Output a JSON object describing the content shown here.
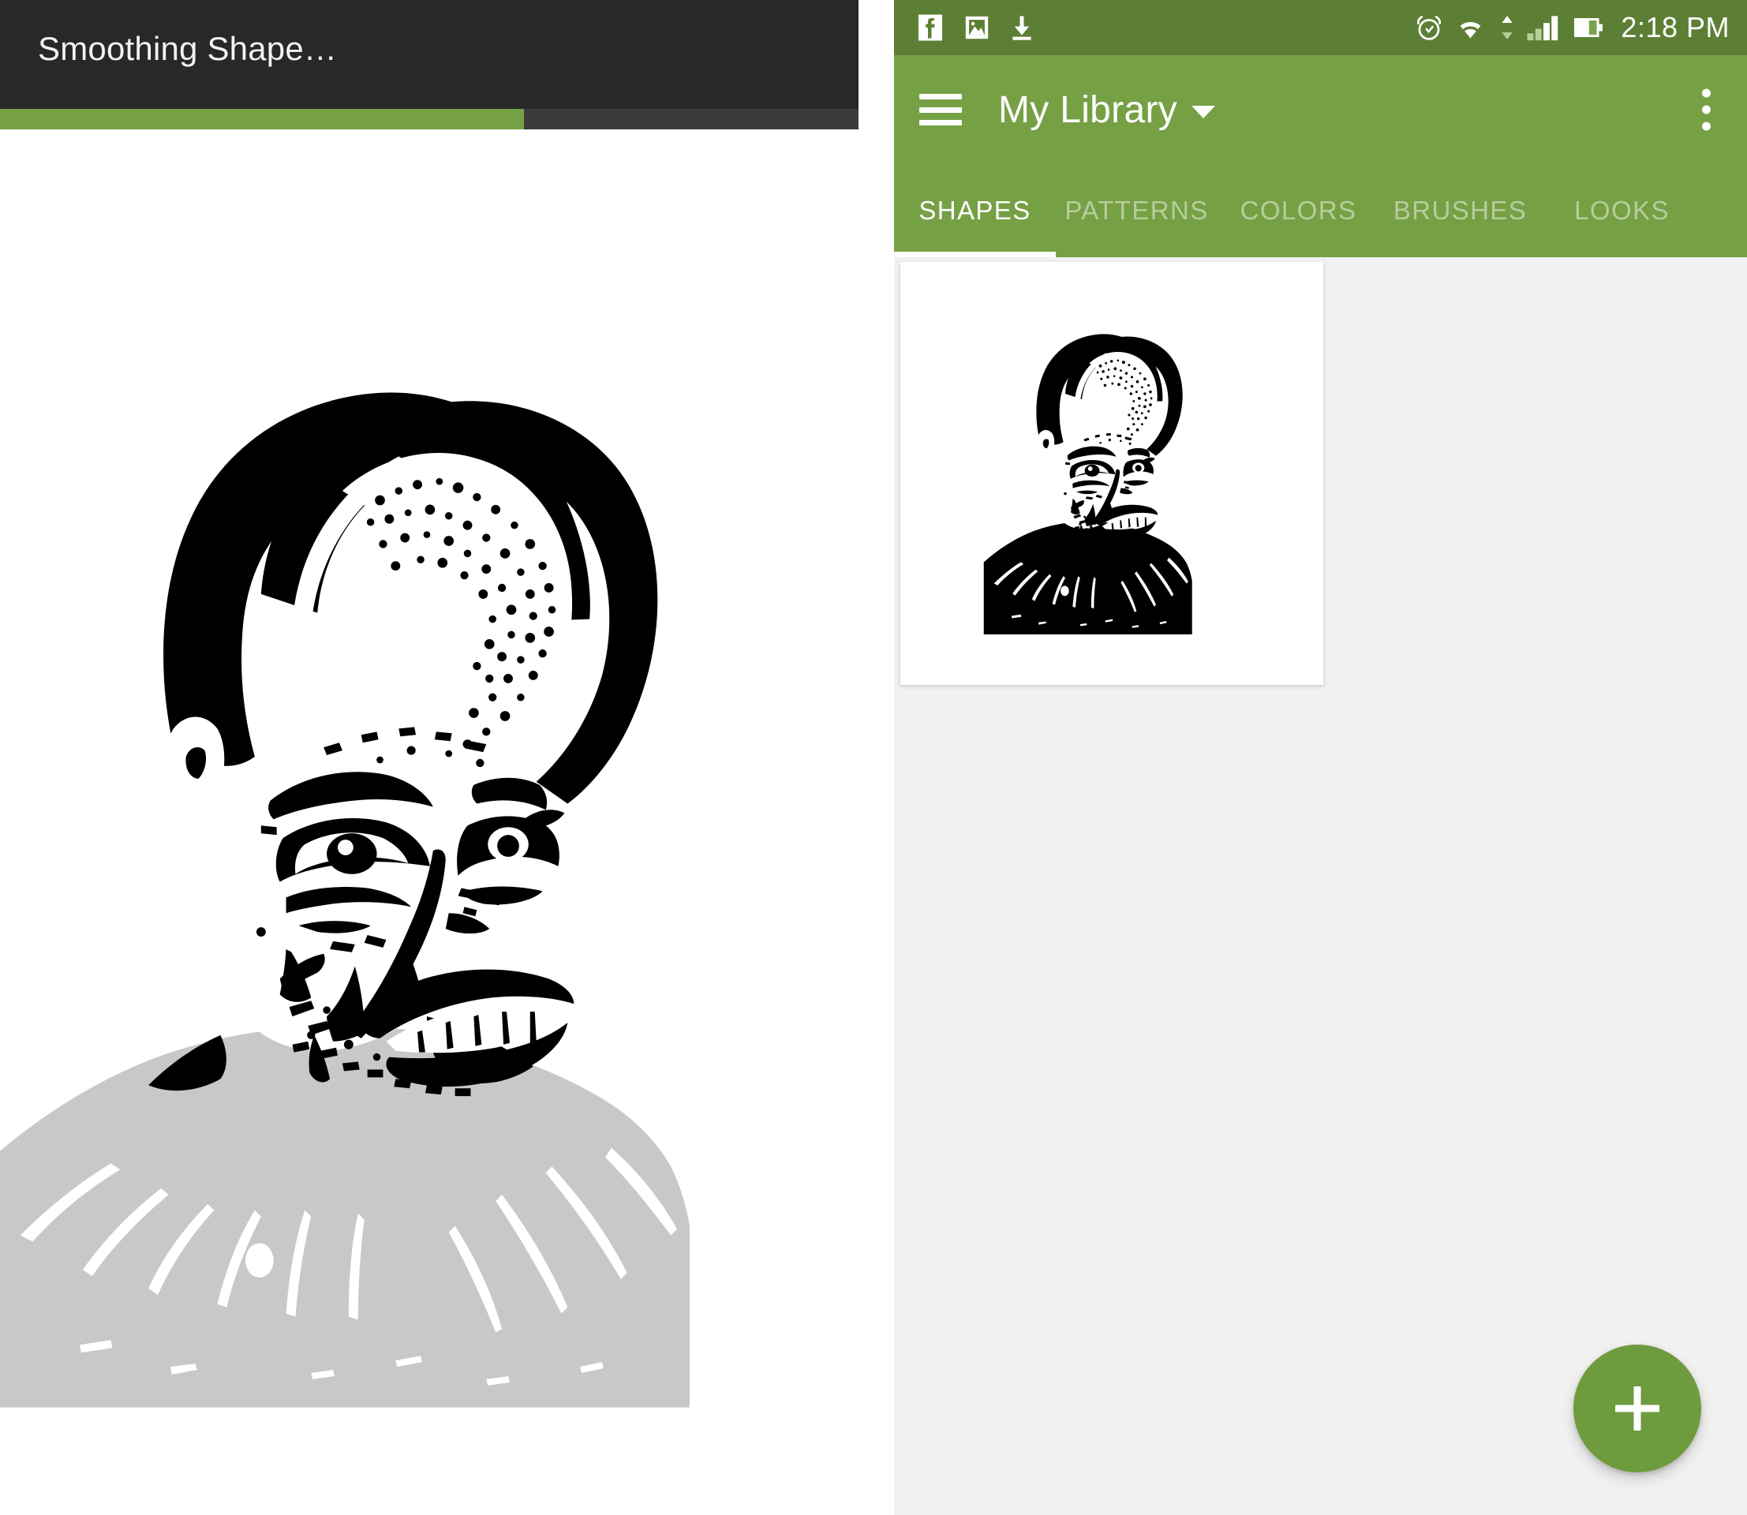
{
  "left_panel": {
    "progress_dialog": {
      "title": "Smoothing Shape…",
      "progress_percent": 61,
      "background_color": "#282828",
      "fill_color": "#76a044",
      "track_color": "#3b3b3b"
    },
    "preview": {
      "name": "shape-preview",
      "description": "Black and white stencil portrait of a smiling person wearing a backwards cap",
      "fill_black": "#000000",
      "fill_gray": "#c8c8c8",
      "background": "#ffffff"
    }
  },
  "right_panel": {
    "status_bar": {
      "time": "2:18 PM",
      "background_color": "#5d7f35",
      "left_icons": [
        "facebook-icon",
        "gallery-icon",
        "download-icon"
      ],
      "right_icons": [
        "alarm-icon",
        "wifi-icon",
        "signal-icon",
        "battery-icon"
      ]
    },
    "app_bar": {
      "menu_icon": "hamburger-icon",
      "title": "My Library",
      "dropdown_icon": "chevron-down-icon",
      "overflow_icon": "overflow-menu-icon",
      "background_color": "#76a044"
    },
    "tabs": {
      "active_index": 0,
      "items": [
        {
          "label": "SHAPES"
        },
        {
          "label": "PATTERNS"
        },
        {
          "label": "COLORS"
        },
        {
          "label": "BRUSHES"
        },
        {
          "label": "LOOKS"
        }
      ]
    },
    "library": {
      "background_color": "#f1f1f1",
      "cards": [
        {
          "name": "shape-thumbnail",
          "description": "Stencil portrait shape"
        }
      ]
    },
    "fab": {
      "label": "+",
      "icon": "plus-icon",
      "color": "#6f9b3f"
    }
  }
}
